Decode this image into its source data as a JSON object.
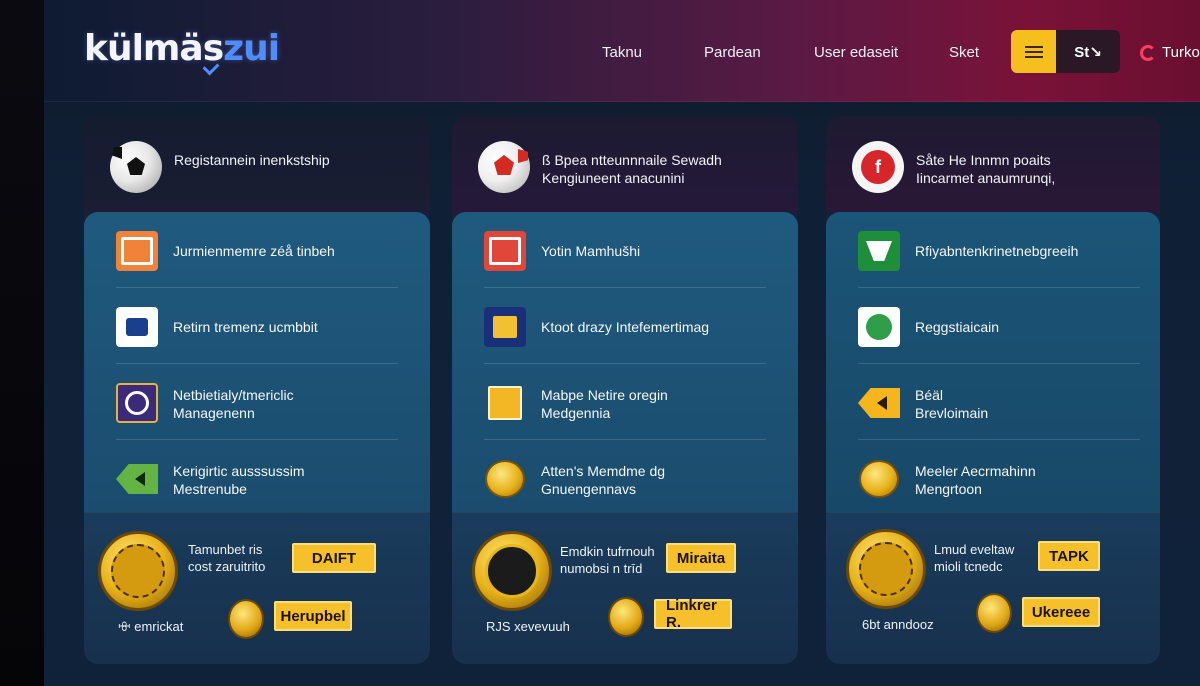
{
  "header": {
    "logo": {
      "main": "külmäs",
      "accent": "zui"
    },
    "nav": [
      "Taknu",
      "Pardean",
      "User edaseit",
      "Sket"
    ],
    "menu_button_icon": "menu-icon",
    "st_button_label": "St↘",
    "language_label": "Turko"
  },
  "columns": [
    {
      "head_icon": "soccer-ball-icon",
      "head_text": [
        "Registannein inenkstship"
      ],
      "rows": [
        {
          "icon": "orange-frame-icon",
          "label": [
            "Jurmienmemre zéå tinbeh"
          ]
        },
        {
          "icon": "bank-card-icon",
          "label": [
            "Retirn tremenz ucmbbit"
          ]
        },
        {
          "icon": "purple-ring-icon",
          "label": [
            "Netbietialy/tmericlic",
            "Managenenn"
          ]
        },
        {
          "icon": "green-arrow-icon",
          "label": [
            "Kerigirtic ausssussim",
            "Mestrenube"
          ]
        }
      ],
      "promo_text": [
        "Tamunbet ris",
        "cost zaruitrito"
      ],
      "cta_primary": "DAIFT",
      "cta_secondary": "Herupbel",
      "footer_link": "ꗳ emrickat"
    },
    {
      "head_icon": "red-ball-icon",
      "head_text": [
        "ß Bpea ntteunnnaile Sewadh",
        "Kengiuneent anacunini"
      ],
      "rows": [
        {
          "icon": "red-frame-icon",
          "label": [
            "Yotin Mamhušhi"
          ]
        },
        {
          "icon": "navy-card-icon",
          "label": [
            "Ktoot drazy Intefemertimag"
          ]
        },
        {
          "icon": "document-icon",
          "label": [
            "Mabpe Netire oregin",
            "Medgennia"
          ]
        },
        {
          "icon": "gold-coin-icon",
          "label": [
            "Atten's Memdme dg",
            "Gnuengennavs"
          ]
        }
      ],
      "promo_text": [
        "Emdkin tufrnouh",
        "numobsi n trīd"
      ],
      "cta_primary": "Miraita",
      "cta_secondary": "Linkrer R.",
      "footer_link": "RJS xevevuuh"
    },
    {
      "head_icon": "red-badge-icon",
      "head_text": [
        "Såte He Innmn poaits",
        "Iincarmet anaumrunqi,"
      ],
      "rows": [
        {
          "icon": "green-shield-icon",
          "label": [
            "Rfiyabntenkrinetnebgreeih"
          ]
        },
        {
          "icon": "green-globe-icon",
          "label": [
            "Reggstiaicain"
          ]
        },
        {
          "icon": "yellow-arrow-icon",
          "label": [
            "Béäl",
            "Brevloimain"
          ]
        },
        {
          "icon": "gold-coin-icon",
          "label": [
            "Meeler Aecrmahinn",
            "Mengrtoon"
          ]
        }
      ],
      "promo_text": [
        "Lmud eveltaw",
        "mioli tcnedc"
      ],
      "cta_primary": "TAPK",
      "cta_secondary": "Ukereee",
      "footer_link": "6bt anndooz"
    }
  ],
  "colors": {
    "accent_yellow": "#f6c02a",
    "list_blue": "#1f5a7e",
    "header_magenta": "#7a1238"
  }
}
